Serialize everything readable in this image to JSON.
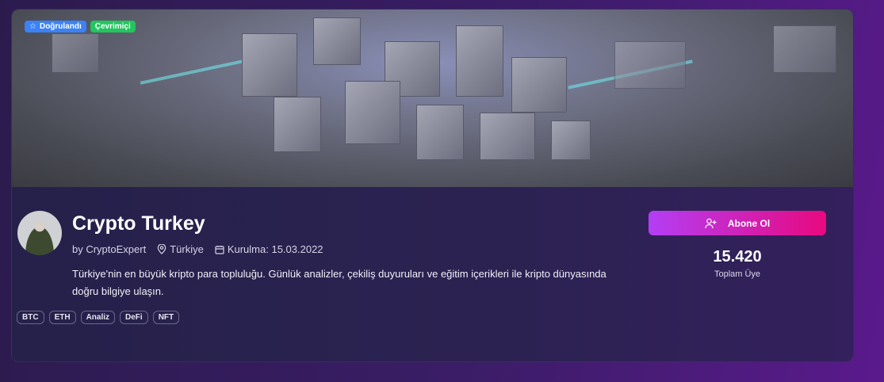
{
  "banner": {
    "badges": [
      {
        "label": "Doğrulandı",
        "icon": "star-icon",
        "color": "#3b82f6"
      },
      {
        "label": "Çevrimiçi",
        "color": "#22c55e"
      }
    ]
  },
  "community": {
    "name": "Crypto Turkey",
    "author": "by CryptoExpert",
    "location": "Türkiye",
    "founded": "Kurulma: 15.03.2022",
    "description": "Türkiye'nin en büyük kripto para topluluğu. Günlük analizler, çekiliş duyuruları ve eğitim içerikleri ile kripto dünyasında doğru bilgiye ulaşın.",
    "tags": [
      "BTC",
      "ETH",
      "Analiz",
      "DeFi",
      "NFT"
    ]
  },
  "actions": {
    "join_label": "Abone Ol",
    "accent_gradient": [
      "#b33ef5",
      "#e8097f"
    ]
  },
  "stats": {
    "members": "15.420",
    "members_label": "Toplam Üye"
  }
}
